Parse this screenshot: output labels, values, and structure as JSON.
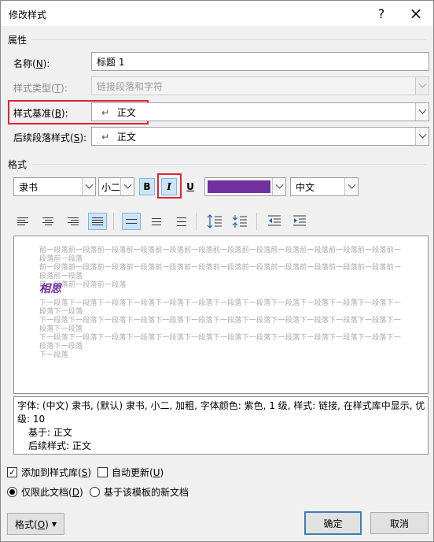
{
  "window": {
    "title": "修改样式",
    "help_icon": "?",
    "close_icon": "×"
  },
  "properties": {
    "group_label": "属性",
    "name": {
      "label": "名称(N):",
      "value": "标题 1"
    },
    "style_type": {
      "label": "样式类型(T):",
      "value": "链接段落和字符"
    },
    "style_based_on": {
      "label": "样式基准(B):",
      "value": "正文",
      "glyph": "↵"
    },
    "following_style": {
      "label": "后续段落样式(S):",
      "value": "正文",
      "glyph": "↵"
    }
  },
  "format": {
    "group_label": "格式",
    "font": "隶书",
    "size": "小二",
    "bold": "B",
    "italic": "I",
    "underline": "U",
    "font_color": "#7030a0",
    "script": "中文"
  },
  "preview": {
    "prev_lines": [
      "前一段落前一段落前一段落前一段落前一段落前一段落前一段落前一段落前一段落前一段落前一段落前一段落前一段落前一段落",
      "前一段落前一段落前一段落前一段落前一段落前一段落前一段落前一段落前一段落前一段落前一段落前一段落前一段落前一段落",
      "前一段落前一段落前一段落"
    ],
    "main_text": "相思",
    "next_lines": [
      "下一段落下一段落下一段落下一段落下一段落下一段落下一段落下一段落下一段落下一段落下一段落下一段落下一段落下一段落",
      "下一段落下一段落下一段落下一段落下一段落下一段落下一段落下一段落下一段落下一段落下一段落下一段落下一段落下一段落",
      "下一段落下一段落下一段落下一段落下一段落下一段落下一段落下一段落下一段落下一段落下一段落下一段落下一段落下一段落",
      "下一段落"
    ]
  },
  "description": {
    "line1": "字体: (中文) 隶书, (默认) 隶书, 小二, 加粗, 字体颜色: 紫色, 1 级, 样式: 链接, 在样式库中显示, 优先",
    "line2": "级: 10",
    "line3": "基于: 正文",
    "line4": "后续样式: 正文"
  },
  "options": {
    "add_to_gallery": {
      "label": "添加到样式库(S)",
      "checked": true
    },
    "auto_update": {
      "label": "自动更新(U)",
      "checked": false
    },
    "only_this_doc": {
      "label": "仅限此文档(D)",
      "selected": true
    },
    "new_docs_template": {
      "label": "基于该模板的新文档",
      "selected": false
    }
  },
  "buttons": {
    "format": "格式(O)",
    "ok": "确定",
    "cancel": "取消"
  }
}
